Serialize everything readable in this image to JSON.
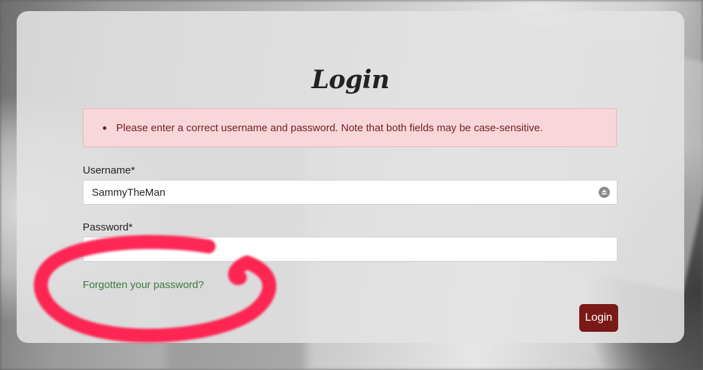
{
  "login": {
    "title": "Login",
    "error_message": "Please enter a correct username and password. Note that both fields may be case-sensitive.",
    "username_label": "Username*",
    "username_value": "SammyTheMan",
    "password_label": "Password*",
    "password_value": "",
    "forgot_link": "Forgotten your password?",
    "submit_label": "Login"
  },
  "colors": {
    "error_bg": "#f8d7da",
    "error_text": "#721c24",
    "link": "#3a7a3a",
    "button": "#7a1a18",
    "annotation": "#ff1f4b"
  }
}
